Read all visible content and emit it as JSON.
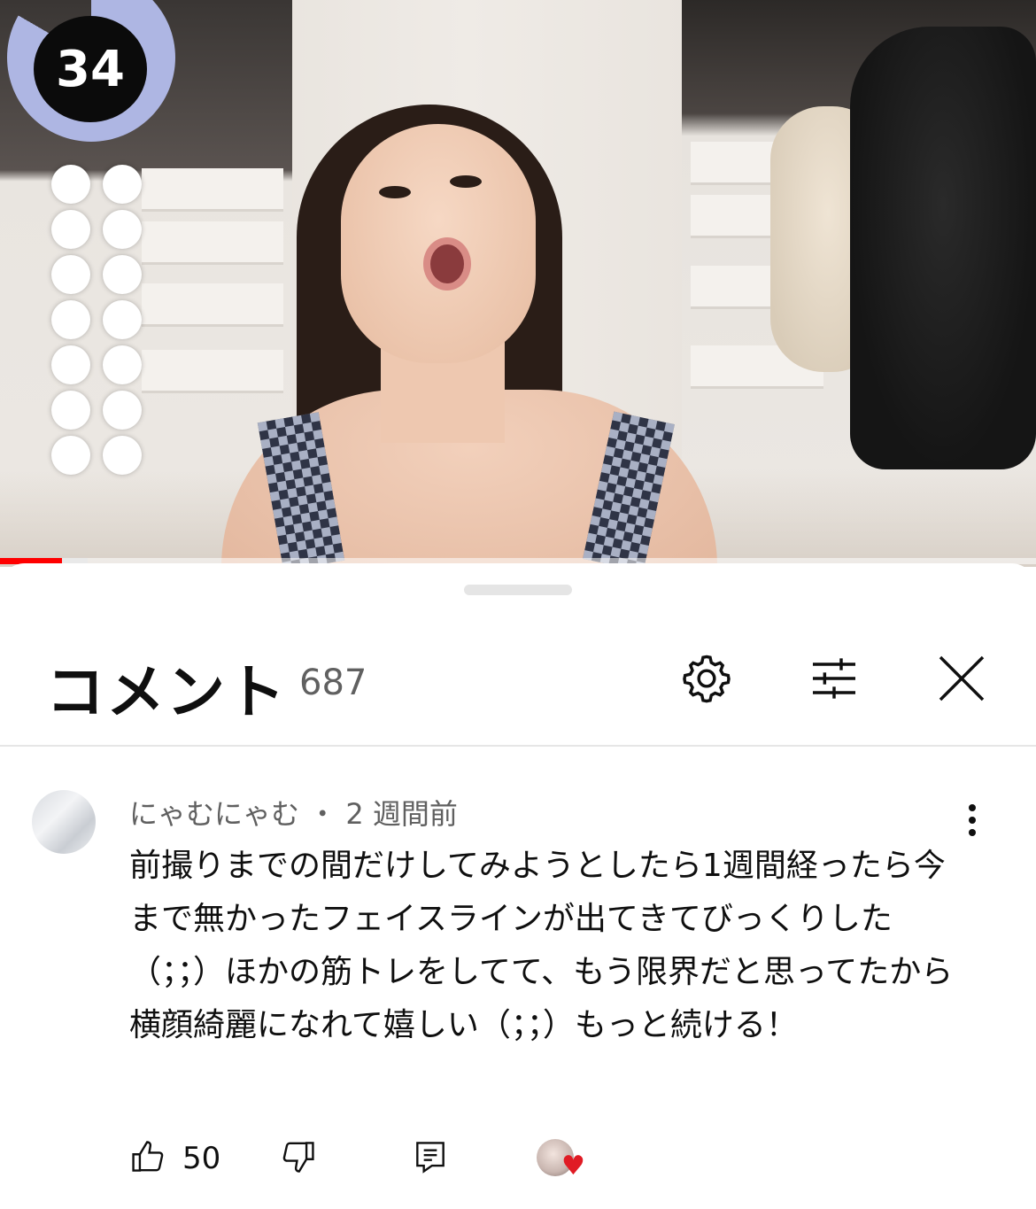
{
  "video": {
    "countdown": "34",
    "progress_fraction": 0.06,
    "buffer_fraction": 0.085,
    "accent_color": "#ff0000"
  },
  "comments_sheet": {
    "title": "コメント",
    "count": "687",
    "icons": [
      "gear-icon",
      "filter-icon",
      "close-icon"
    ]
  },
  "comment": {
    "author": "にゃむにゃむ",
    "separator": "・",
    "time": "2 週間前",
    "text": "前撮りまでの間だけしてみようとしたら1週間経ったら今まで無かったフェイスラインが出てきてびっくりした（；；）ほかの筋トレをしてて、もう限界だと思ってたから横顔綺麗になれて嬉しい（；；）もっと続ける！",
    "likes": "50",
    "creator_heart_color": "#e01b24"
  }
}
